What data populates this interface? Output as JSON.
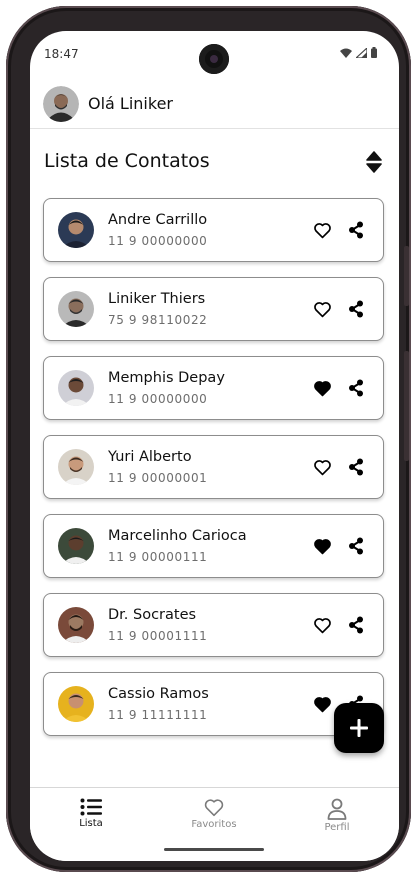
{
  "status_bar": {
    "time": "18:47",
    "icons": [
      "wifi-icon",
      "signal-icon",
      "battery-icon"
    ]
  },
  "header": {
    "greeting": "Olá Liniker",
    "avatar_icon": "user-avatar"
  },
  "list": {
    "title": "Lista de Contatos",
    "sort_icon": "sort-up-down-icon"
  },
  "contacts": [
    {
      "name": "Andre Carrillo",
      "phone": "11 9 00000000",
      "favorite": false,
      "avatar_bg": "#2b3a55",
      "avatar_skin": "#b58a6e"
    },
    {
      "name": "Liniker Thiers",
      "phone": "75 9 98110022",
      "favorite": false,
      "avatar_bg": "#b9b9b9",
      "avatar_skin": "#8a6e5c"
    },
    {
      "name": "Memphis Depay",
      "phone": "11 9 00000000",
      "favorite": true,
      "avatar_bg": "#cfcfd6",
      "avatar_skin": "#6b4a38"
    },
    {
      "name": "Yuri Alberto",
      "phone": "11 9 00000001",
      "favorite": false,
      "avatar_bg": "#d8d2c8",
      "avatar_skin": "#c89a7c"
    },
    {
      "name": "Marcelinho Carioca",
      "phone": "11 9 00000111",
      "favorite": true,
      "avatar_bg": "#3c4a3a",
      "avatar_skin": "#5c3e2e"
    },
    {
      "name": "Dr. Socrates",
      "phone": "11 9 00001111",
      "favorite": false,
      "avatar_bg": "#7a4a3a",
      "avatar_skin": "#9c7a62"
    },
    {
      "name": "Cassio Ramos",
      "phone": "11 9 11111111",
      "favorite": true,
      "avatar_bg": "#e6b21e",
      "avatar_skin": "#c89070"
    }
  ],
  "fab": {
    "icon": "plus-icon"
  },
  "bottom_nav": [
    {
      "label": "Lista",
      "icon": "list-icon",
      "active": true
    },
    {
      "label": "Favoritos",
      "icon": "heart-outline-icon",
      "active": false
    },
    {
      "label": "Perfil",
      "icon": "person-icon",
      "active": false
    }
  ],
  "colors": {
    "primary": "#000000",
    "text_secondary": "#6d6d6d",
    "inactive": "#8a8a8a",
    "card_border": "#8d8d8d"
  }
}
